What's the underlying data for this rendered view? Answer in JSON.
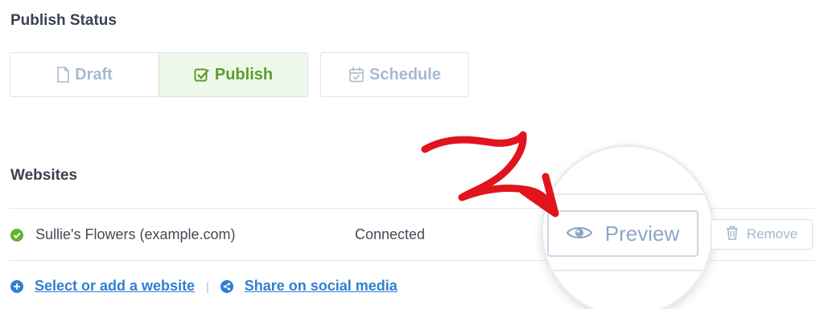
{
  "publish_status": {
    "title": "Publish Status",
    "tabs": [
      {
        "label": "Draft",
        "icon": "document-icon"
      },
      {
        "label": "Publish",
        "icon": "checkbox-icon",
        "active": true
      },
      {
        "label": "Schedule",
        "icon": "calendar-icon"
      }
    ]
  },
  "websites": {
    "title": "Websites",
    "rows": [
      {
        "name": "Sullie's Flowers (example.com)",
        "status": "Connected",
        "preview_label": "Preview",
        "remove_label": "Remove"
      }
    ]
  },
  "links": {
    "select_add": "Select or add a website",
    "separator": "|",
    "share": "Share on social media"
  },
  "colors": {
    "accent": "#5e9c2c",
    "link": "#2f7fd1",
    "annotation_arrow": "#e1141d"
  }
}
